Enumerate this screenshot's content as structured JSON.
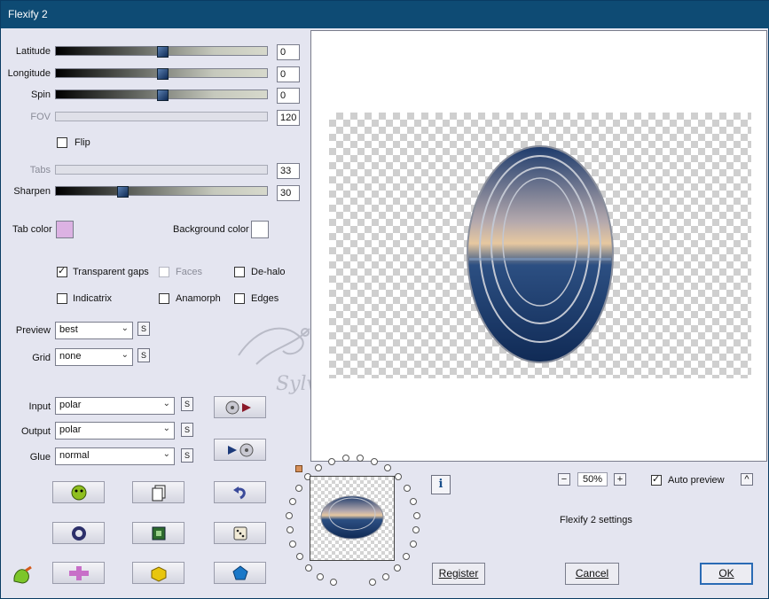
{
  "window": {
    "title": "Flexify 2"
  },
  "sliders": [
    {
      "label": "Latitude",
      "value": "0",
      "fraction": 0.5,
      "enabled": true
    },
    {
      "label": "Longitude",
      "value": "0",
      "fraction": 0.5,
      "enabled": true
    },
    {
      "label": "Spin",
      "value": "0",
      "fraction": 0.5,
      "enabled": true
    },
    {
      "label": "FOV",
      "value": "120",
      "enabled": false
    },
    {
      "label": "Tabs",
      "value": "33",
      "enabled": false
    },
    {
      "label": "Sharpen",
      "value": "30",
      "fraction": 0.3,
      "enabled": true
    }
  ],
  "flip": {
    "label": "Flip",
    "checked": false
  },
  "colors": {
    "tab_label": "Tab color",
    "tab_color": "#dcb2e3",
    "bg_label": "Background color",
    "bg_color": "#ffffff"
  },
  "options": {
    "transparent_gaps": "Transparent gaps",
    "faces": "Faces",
    "dehalo": "De-halo",
    "indicatrix": "Indicatrix",
    "anamorph": "Anamorph",
    "edges": "Edges"
  },
  "preview_select": {
    "label": "Preview",
    "value": "best"
  },
  "grid_select": {
    "label": "Grid",
    "value": "none"
  },
  "input_select": {
    "label": "Input",
    "value": "polar"
  },
  "output_select": {
    "label": "Output",
    "value": "polar"
  },
  "glue_select": {
    "label": "Glue",
    "value": "normal"
  },
  "s_label": "S",
  "watermark": "Sylviane",
  "zoom": {
    "value": "50%",
    "minus": "−",
    "plus": "+"
  },
  "auto_preview": {
    "label": "Auto preview",
    "checked": true,
    "toggle": "^"
  },
  "info_icon": "i",
  "settings_label": "Flexify 2 settings",
  "buttons": {
    "register": "Register",
    "cancel": "Cancel",
    "ok": "OK"
  },
  "accent": "#0e4b74"
}
